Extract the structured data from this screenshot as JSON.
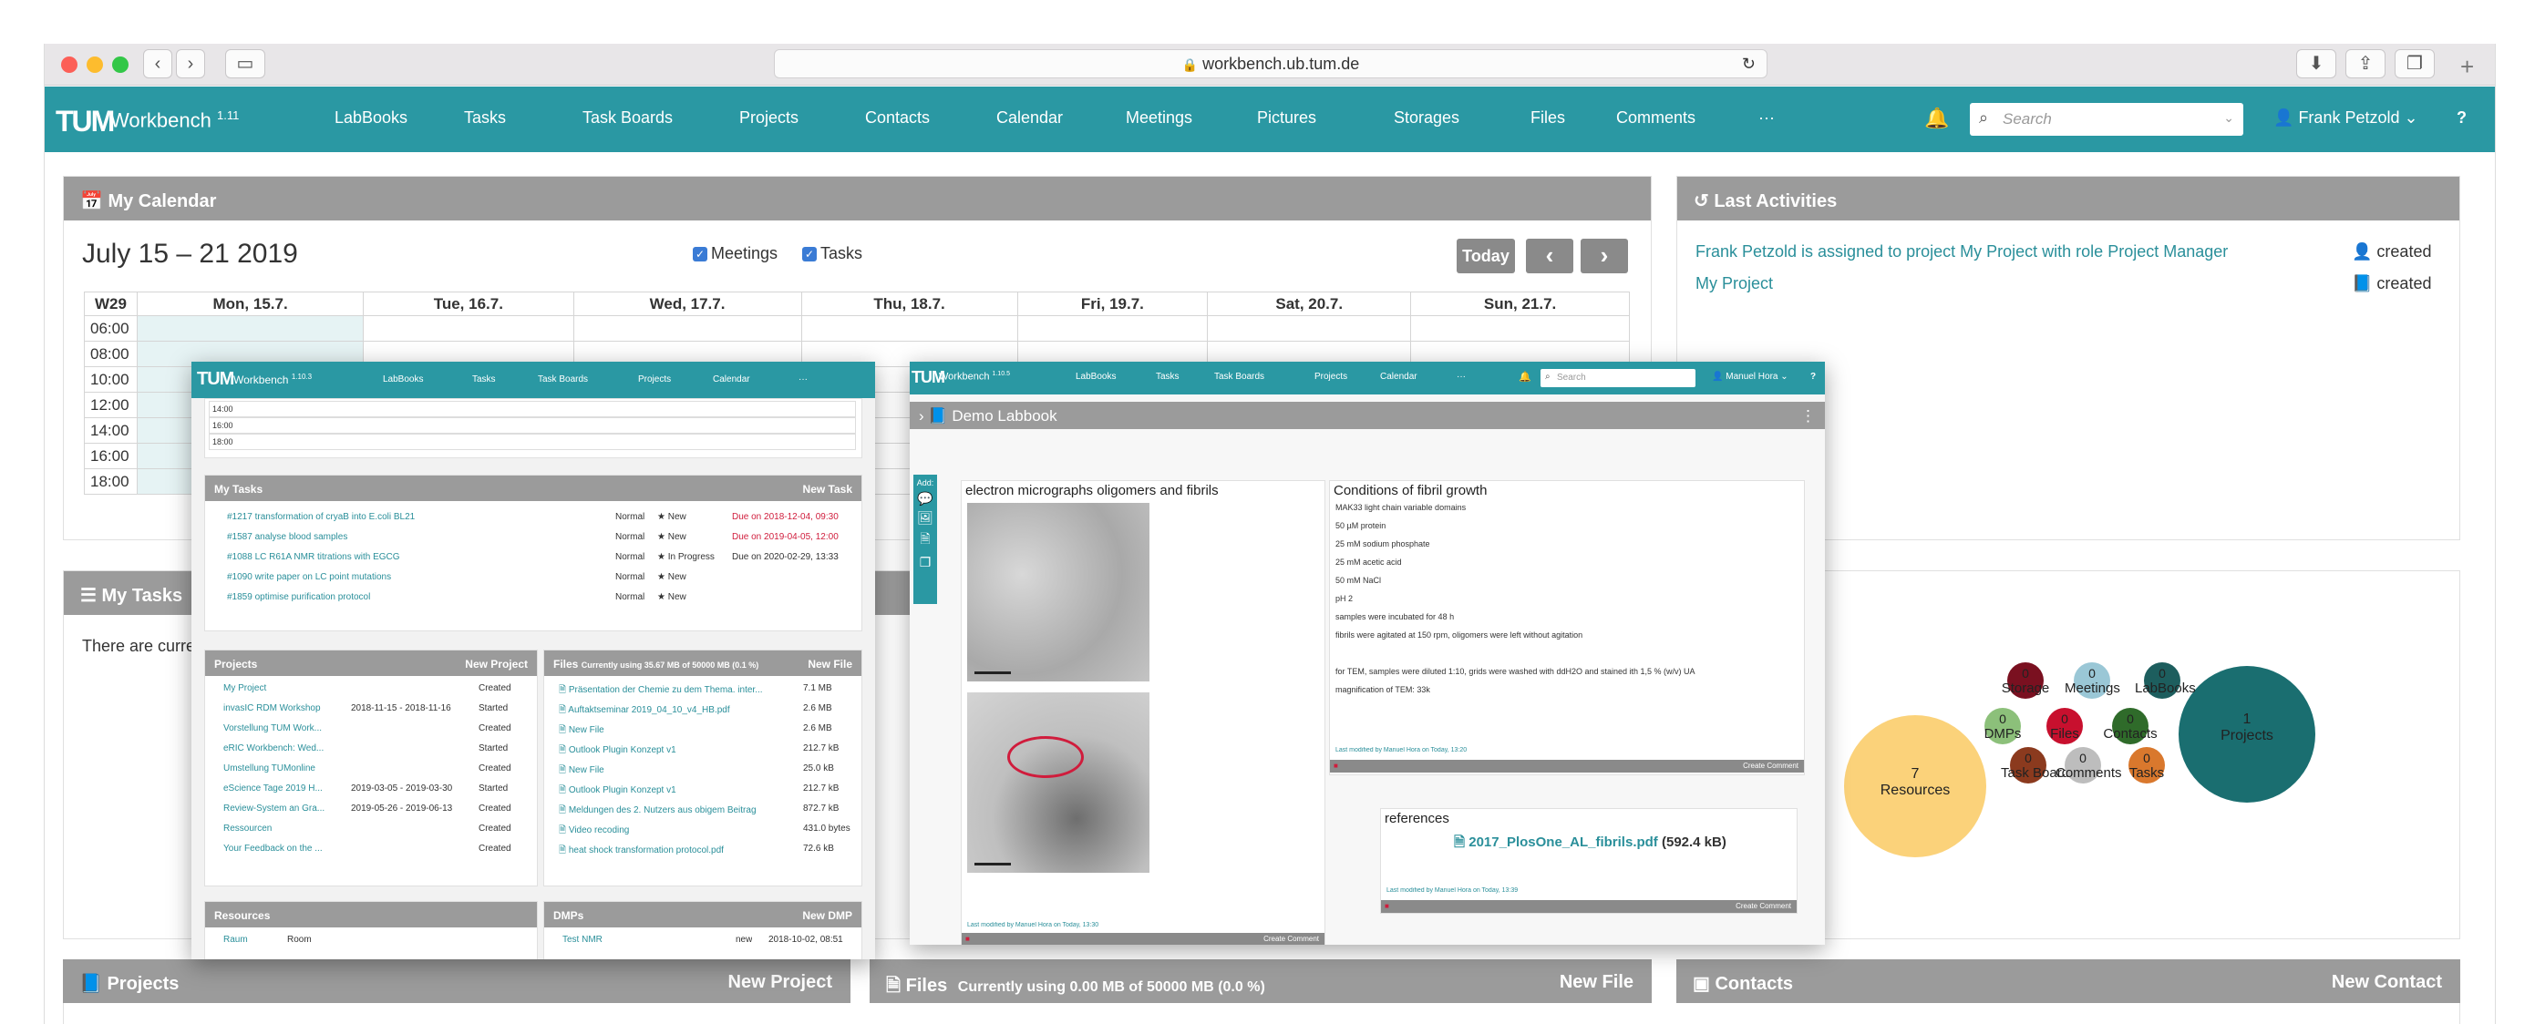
{
  "browser": {
    "url": "workbench.ub.tum.de"
  },
  "nav": {
    "logo": "TUM",
    "app_name": "Workbench",
    "version": "1.11",
    "items": [
      "LabBooks",
      "Tasks",
      "Task Boards",
      "Projects",
      "Contacts",
      "Calendar",
      "Meetings",
      "Pictures",
      "Storages",
      "Files",
      "Comments",
      "···"
    ],
    "search_placeholder": "Search",
    "user": "Frank Petzold",
    "help": "?"
  },
  "calendar": {
    "header": "My Calendar",
    "range": "July 15 – 21 2019",
    "meetings_label": "Meetings",
    "tasks_label": "Tasks",
    "today_button": "Today",
    "prev": "‹",
    "next": "›",
    "week": "W29",
    "days": [
      "Mon, 15.7.",
      "Tue, 16.7.",
      "Wed, 17.7.",
      "Thu, 18.7.",
      "Fri, 19.7.",
      "Sat, 20.7.",
      "Sun, 21.7."
    ],
    "times": [
      "06:00",
      "08:00",
      "10:00",
      "12:00",
      "14:00",
      "16:00",
      "18:00"
    ]
  },
  "activities": {
    "header": "Last Activities",
    "items": [
      {
        "text": "Frank Petzold is assigned to project My Project with role Project Manager",
        "action": "created"
      },
      {
        "text": "My Project",
        "action": "created"
      }
    ]
  },
  "tasks_panel": {
    "header": "My Tasks",
    "empty_text": "There are curren"
  },
  "bubbles": {
    "resources": {
      "count": "7",
      "label": "Resources"
    },
    "projects": {
      "count": "1",
      "label": "Projects"
    },
    "small": [
      {
        "count": "0",
        "label": "Storage",
        "color": "#7a1020"
      },
      {
        "count": "0",
        "label": "Meetings",
        "color": "#9ac7d6"
      },
      {
        "count": "0",
        "label": "LabBooks",
        "color": "#1d5e5e"
      },
      {
        "count": "0",
        "label": "DMPs",
        "color": "#8cc07a"
      },
      {
        "count": "0",
        "label": "Files",
        "color": "#c8102e"
      },
      {
        "count": "0",
        "label": "Contacts",
        "color": "#2f6b2a"
      },
      {
        "count": "0",
        "label": "Task Boards",
        "color": "#8b3a1e"
      },
      {
        "count": "0",
        "label": "Comments",
        "color": "#bdbdbd"
      },
      {
        "count": "0",
        "label": "Tasks",
        "color": "#d9782d"
      }
    ]
  },
  "bottom": {
    "projects_header": "Projects",
    "projects_new": "New Project",
    "files_header": "Files",
    "files_usage": "Currently using 0.00 MB of 50000 MB (0.0 %)",
    "files_new": "New File",
    "contacts_header": "Contacts",
    "contacts_new": "New Contact"
  },
  "overlay1": {
    "app_name": "Workbench",
    "version": "1.10.3",
    "nav": [
      "LabBooks",
      "Tasks",
      "Task Boards",
      "Projects",
      "Calendar",
      "···"
    ],
    "cal_times": [
      "14:00",
      "16:00",
      "18:00"
    ],
    "tasks_header": "My Tasks",
    "tasks_new": "New Task",
    "tasks": [
      {
        "title": "#1217 transformation of cryaB into E.coli BL21",
        "prio": "Normal",
        "state": "New",
        "due": "Due on 2018-12-04, 09:30",
        "overdue": true
      },
      {
        "title": "#1587 analyse blood samples",
        "prio": "Normal",
        "state": "New",
        "due": "Due on 2019-04-05, 12:00",
        "overdue": true
      },
      {
        "title": "#1088 LC R61A NMR titrations with EGCG",
        "prio": "Normal",
        "state": "In Progress",
        "due": "Due on 2020-02-29, 13:33",
        "overdue": false
      },
      {
        "title": "#1090 write paper on LC point mutations",
        "prio": "Normal",
        "state": "New",
        "due": "",
        "overdue": false
      },
      {
        "title": "#1859 optimise purification protocol",
        "prio": "Normal",
        "state": "New",
        "due": "",
        "overdue": false
      }
    ],
    "projects_header": "Projects",
    "projects_new": "New Project",
    "projects": [
      {
        "name": "My Project",
        "dates": "",
        "state": "Created"
      },
      {
        "name": "invasIC RDM Workshop",
        "dates": "2018-11-15 - 2018-11-16",
        "state": "Started"
      },
      {
        "name": "Vorstellung TUM Work...",
        "dates": "",
        "state": "Created"
      },
      {
        "name": "eRIC Workbench: Wed...",
        "dates": "",
        "state": "Started"
      },
      {
        "name": "Umstellung TUMonline",
        "dates": "",
        "state": "Created"
      },
      {
        "name": "eScience Tage 2019 H...",
        "dates": "2019-03-05 - 2019-03-30",
        "state": "Started"
      },
      {
        "name": "Review-System an Gra...",
        "dates": "2019-05-26 - 2019-06-13",
        "state": "Created"
      },
      {
        "name": "Ressourcen",
        "dates": "",
        "state": "Created"
      },
      {
        "name": "Your Feedback on the ...",
        "dates": "",
        "state": "Created"
      }
    ],
    "files_header": "Files",
    "files_usage": "Currently using 35.67 MB of 50000 MB (0.1 %)",
    "files_new": "New File",
    "files": [
      {
        "name": "Präsentation der Chemie zu dem Thema. inter...",
        "size": "7.1 MB"
      },
      {
        "name": "Auftaktseminar 2019_04_10_v4_HB.pdf",
        "size": "2.6 MB"
      },
      {
        "name": "New File",
        "size": "2.6 MB"
      },
      {
        "name": "Outlook Plugin Konzept v1",
        "size": "212.7 kB"
      },
      {
        "name": "New File",
        "size": "25.0 kB"
      },
      {
        "name": "Outlook Plugin Konzept v1",
        "size": "212.7 kB"
      },
      {
        "name": "Meldungen des 2. Nutzers aus obigem Beitrag",
        "size": "872.7 kB"
      },
      {
        "name": "Video recoding",
        "size": "431.0 bytes"
      },
      {
        "name": "heat shock transformation protocol.pdf",
        "size": "72.6 kB"
      }
    ],
    "resources_header": "Resources",
    "resources": [
      {
        "name": "Raum",
        "type": "Room"
      }
    ],
    "dmps_header": "DMPs",
    "dmps_new": "New DMP",
    "dmps": [
      {
        "name": "Test NMR",
        "state": "new",
        "date": "2018-10-02, 08:51"
      }
    ]
  },
  "overlay2": {
    "app_name": "Workbench",
    "version": "1.10.5",
    "nav": [
      "LabBooks",
      "Tasks",
      "Task Boards",
      "Projects",
      "Calendar",
      "···"
    ],
    "search_placeholder": "Search",
    "user": "Manuel Hora",
    "labbook_title": "Demo Labbook",
    "add_label": "Add:",
    "cell1_title": "electron micrographs oligomers and fibrils",
    "cell1_footer": "Last modified by Manuel Hora on Today, 13:30",
    "cell1_comment": "Create Comment",
    "cell2_title": "Conditions of fibril growth",
    "cell2_lines": [
      "MAK33 light chain variable domains",
      "50 µM protein",
      "25 mM sodium phosphate",
      "25 mM acetic acid",
      "50 mM NaCl",
      "pH 2",
      "samples were incubated for 48 h",
      "fibrils were agitated at 150 rpm, oligomers were left without agitation",
      "",
      "for TEM, samples were diluted 1:10, grids were washed with ddH2O and stained ith 1,5 % (w/v) UA",
      "magnification of TEM: 33k"
    ],
    "cell2_footer": "Last modified by Manuel Hora on Today, 13:20",
    "cell2_comment": "Create Comment",
    "cell3_title": "references",
    "cell3_file": "2017_PlosOne_AL_fibrils.pdf",
    "cell3_size": "(592.4 kB)",
    "cell3_footer": "Last modified by Manuel Hora on Today, 13:39",
    "cell3_comment": "Create Comment"
  }
}
